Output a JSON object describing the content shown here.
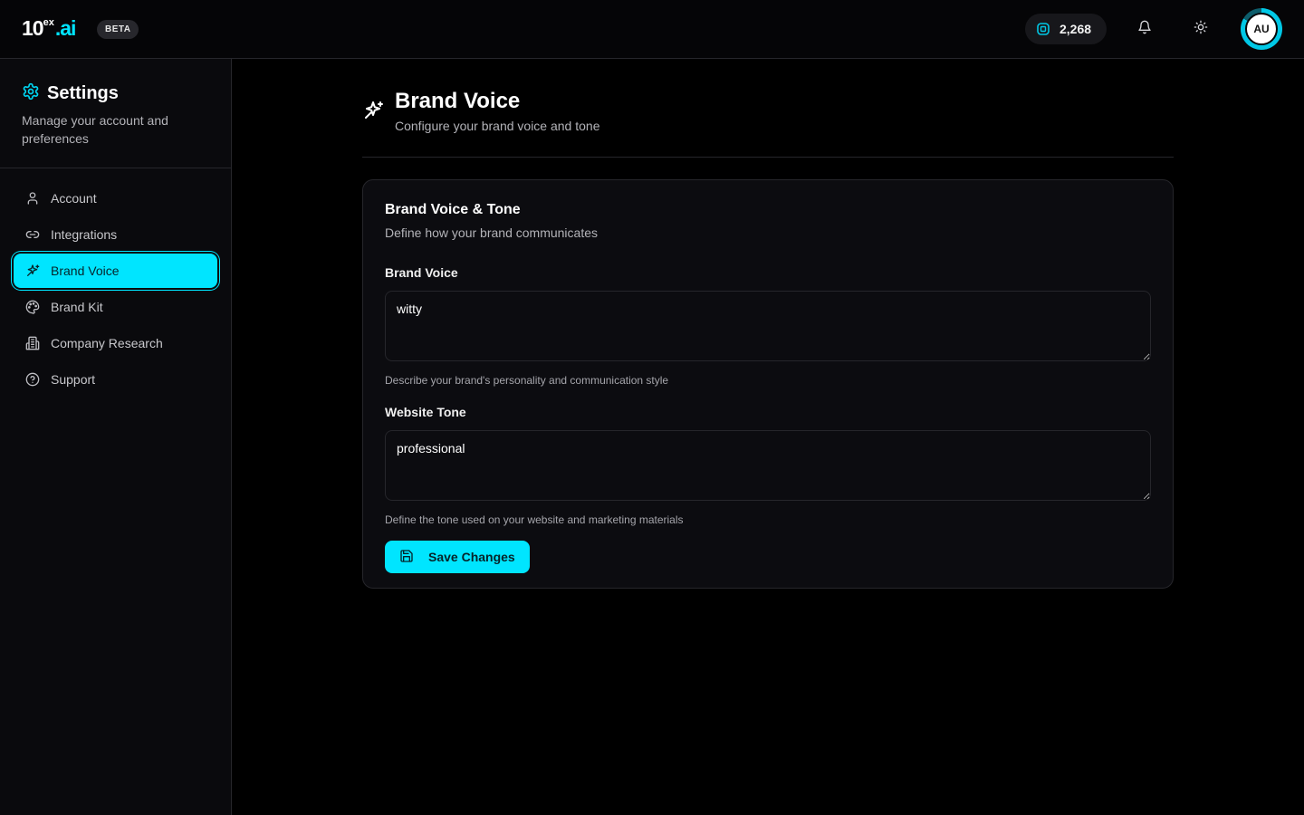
{
  "app": {
    "logo_main": "10",
    "logo_sup": "ex",
    "logo_suffix": ".ai",
    "beta_label": "BETA",
    "credits_value": "2,268",
    "avatar_initials": "AU",
    "accent_color": "#00e5ff"
  },
  "icons": {
    "credits": "coin-icon",
    "notifications": "bell-icon",
    "theme": "sun-icon",
    "settings": "gear-icon",
    "brand_voice": "sparkles-icon",
    "save": "floppy-disk-icon"
  },
  "sidebar": {
    "title": "Settings",
    "description": "Manage your account and preferences",
    "items": [
      {
        "label": "Account",
        "icon": "user-icon",
        "active": false
      },
      {
        "label": "Integrations",
        "icon": "link-icon",
        "active": false
      },
      {
        "label": "Brand Voice",
        "icon": "sparkles-icon",
        "active": true
      },
      {
        "label": "Brand Kit",
        "icon": "palette-icon",
        "active": false
      },
      {
        "label": "Company Research",
        "icon": "building-icon",
        "active": false
      },
      {
        "label": "Support",
        "icon": "help-circle-icon",
        "active": false
      }
    ]
  },
  "page": {
    "title": "Brand Voice",
    "subtitle": "Configure your brand voice and tone"
  },
  "card": {
    "title": "Brand Voice & Tone",
    "description": "Define how your brand communicates",
    "fields": [
      {
        "label": "Brand Voice",
        "value": "witty",
        "help": "Describe your brand's personality and communication style"
      },
      {
        "label": "Website Tone",
        "value": "professional",
        "help": "Define the tone used on your website and marketing materials"
      }
    ],
    "save_label": "Save Changes"
  }
}
